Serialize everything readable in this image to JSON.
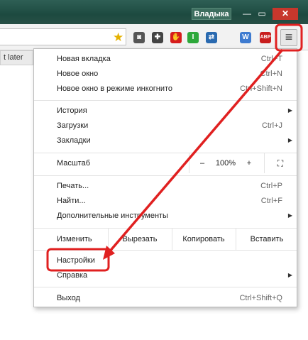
{
  "window": {
    "user_badge": "Владыка",
    "min_glyph": "—",
    "max_glyph": "▭",
    "close_glyph": "✕"
  },
  "toolbar": {
    "star_glyph": "★",
    "menu_glyph": "≡",
    "extensions": [
      {
        "name": "pocket-icon",
        "color": "#555555",
        "glyph": "◙"
      },
      {
        "name": "puzzle-icon",
        "color": "#444444",
        "glyph": "✚"
      },
      {
        "name": "adblock-icon",
        "color": "#d61c1c",
        "glyph": "✋"
      },
      {
        "name": "power-icon",
        "color": "#2da83a",
        "glyph": "I"
      },
      {
        "name": "translate-icon",
        "color": "#2a6ab0",
        "glyph": "⇄"
      },
      {
        "name": "web-icon",
        "color": "#3e7bd0",
        "glyph": "W"
      },
      {
        "name": "abp-icon",
        "color": "#c81e1e",
        "glyph": "ABP"
      }
    ]
  },
  "page": {
    "later_button": "t later"
  },
  "menu": {
    "new_tab": "Новая вкладка",
    "new_tab_sc": "Ctrl+T",
    "new_window": "Новое окно",
    "new_window_sc": "Ctrl+N",
    "incognito": "Новое окно в режиме инкогнито",
    "incognito_sc": "Ctrl+Shift+N",
    "history": "История",
    "downloads": "Загрузки",
    "downloads_sc": "Ctrl+J",
    "bookmarks": "Закладки",
    "zoom": "Масштаб",
    "zoom_minus": "–",
    "zoom_value": "100%",
    "zoom_plus": "+",
    "fullscreen_glyph": "⛶",
    "print": "Печать...",
    "print_sc": "Ctrl+P",
    "find": "Найти...",
    "find_sc": "Ctrl+F",
    "more_tools": "Дополнительные инструменты",
    "edit": "Изменить",
    "cut": "Вырезать",
    "copy": "Копировать",
    "paste": "Вставить",
    "settings": "Настройки",
    "help": "Справка",
    "exit": "Выход",
    "exit_sc": "Ctrl+Shift+Q",
    "arrow_glyph": "▶"
  },
  "annotation_color": "#e02020"
}
